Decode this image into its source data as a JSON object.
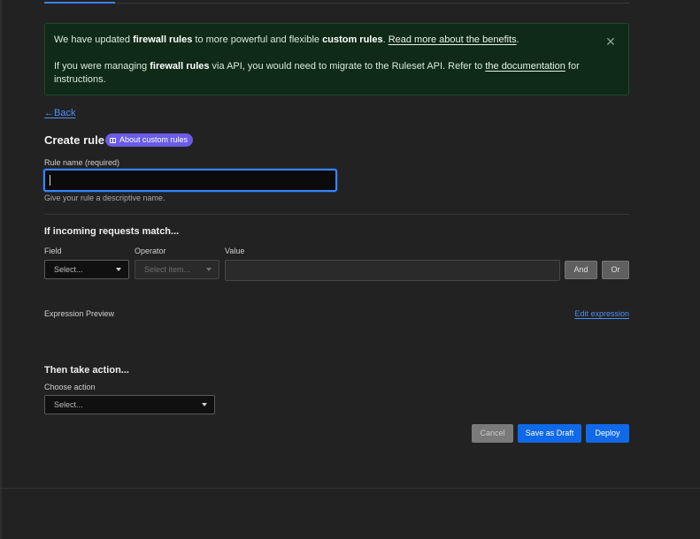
{
  "banner": {
    "line1_pre": "We have updated ",
    "line1_b1": "firewall rules",
    "line1_mid": " to more powerful and flexible ",
    "line1_b2": "custom rules",
    "line1_dot": ".",
    "line1_link": "Read more about the benefits",
    "line1_end": ".",
    "line2_pre": "If you were managing ",
    "line2_b": "firewall rules",
    "line2_mid": " via API, you would need to migrate to the Ruleset API. Refer to ",
    "line2_link": "the documentation",
    "line2_end": " for instructions.",
    "close_glyph": "✕"
  },
  "nav": {
    "back_label": "←Back"
  },
  "page": {
    "title": "Create rule",
    "pill_label": "About custom rules"
  },
  "rule_name": {
    "label": "Rule name (required)",
    "value": "",
    "hint": "Give your rule a descriptive name."
  },
  "match": {
    "title": "If incoming requests match...",
    "field_label": "Field",
    "operator_label": "Operator",
    "value_label": "Value",
    "field_placeholder": "Select...",
    "operator_placeholder": "Select item...",
    "and_label": "And",
    "or_label": "Or"
  },
  "expression": {
    "label": "Expression Preview",
    "edit_link": "Edit expression"
  },
  "action": {
    "title": "Then take action...",
    "choose_label": "Choose action",
    "placeholder": "Select..."
  },
  "footer": {
    "cancel": "Cancel",
    "save_draft": "Save as Draft",
    "deploy": "Deploy"
  },
  "colors": {
    "accent": "#1069e8",
    "link": "#4d8ff7",
    "banner_bg": "#0f2a17",
    "pill": "#6b5ce7"
  },
  "icons": {
    "close": "close-icon",
    "book": "book-icon",
    "caret": "chevron-down-icon"
  }
}
